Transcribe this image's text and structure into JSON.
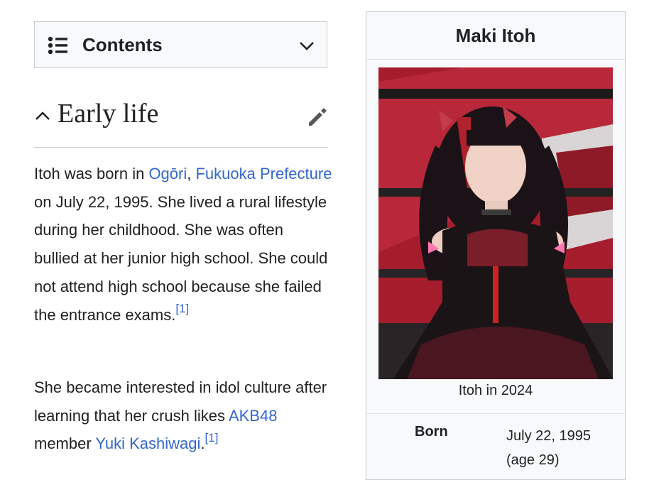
{
  "toc": {
    "title": "Contents",
    "icons": {
      "list": "list-bullet-icon",
      "toggle": "chevron-down-icon"
    }
  },
  "section": {
    "heading": "Early life",
    "icons": {
      "collapse": "chevron-up-icon",
      "edit": "pencil-icon"
    }
  },
  "paragraphs": {
    "p1": {
      "t1": "Itoh was born in ",
      "link1": "Ogōri",
      "t2": ", ",
      "link2": "Fukuoka Prefecture",
      "t3": " on July 22, 1995. She lived a rural lifestyle during her childhood. She was often bullied at her junior high school. She could not attend high school because she failed the entrance exams.",
      "ref": "[1]"
    },
    "p2": {
      "t1": "She became interested in idol culture after learning that her crush likes ",
      "link1": "AKB48",
      "t2": " member ",
      "link2": "Yuki Kashiwagi",
      "t3": ".",
      "ref": "[1]"
    }
  },
  "infobox": {
    "title": "Maki Itoh",
    "caption": "Itoh in 2024",
    "rows": [
      {
        "label": "Born",
        "value_line1": "July 22, 1995",
        "value_line2": "(age 29)"
      }
    ]
  },
  "colors": {
    "link": "#3366cc",
    "text": "#202122",
    "border": "#c8ccd1",
    "panel": "#f8f9fa"
  }
}
